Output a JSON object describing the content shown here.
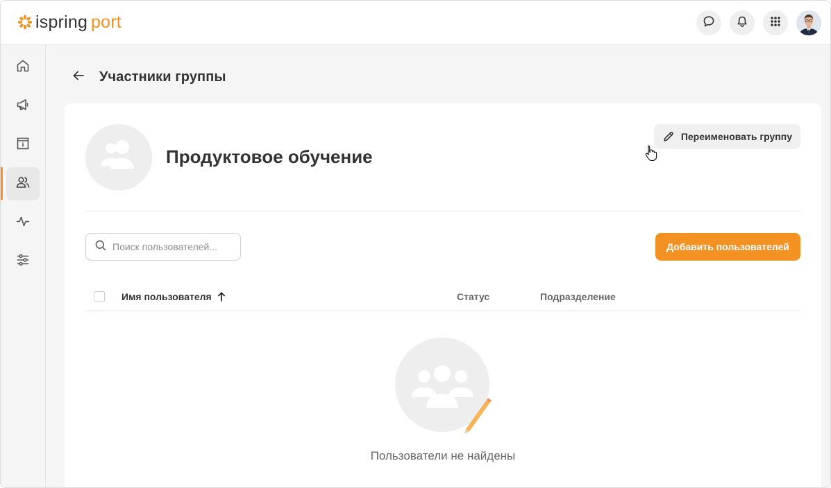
{
  "app": {
    "brand": "ispring",
    "product": "port",
    "accent": "#f39222"
  },
  "header": {
    "icons": [
      "chat-icon",
      "bell-icon",
      "apps-grid-icon"
    ],
    "avatar_icon": "user-avatar"
  },
  "sidebar": {
    "items": [
      {
        "icon": "home-icon",
        "active": false
      },
      {
        "icon": "megaphone-icon",
        "active": false
      },
      {
        "icon": "catalog-icon",
        "active": false
      },
      {
        "icon": "users-icon",
        "active": true
      },
      {
        "icon": "activity-icon",
        "active": false
      },
      {
        "icon": "settings-sliders-icon",
        "active": false
      }
    ]
  },
  "page": {
    "title": "Участники группы"
  },
  "group": {
    "name": "Продуктовое обучение",
    "rename_label": "Переименовать группу"
  },
  "toolbar": {
    "search_placeholder": "Поиск пользователей...",
    "add_label": "Добавить пользователей"
  },
  "table": {
    "columns": [
      "Имя пользователя",
      "Статус",
      "Подразделение"
    ],
    "sort": "asc"
  },
  "empty": {
    "message": "Пользователи не найдены"
  }
}
